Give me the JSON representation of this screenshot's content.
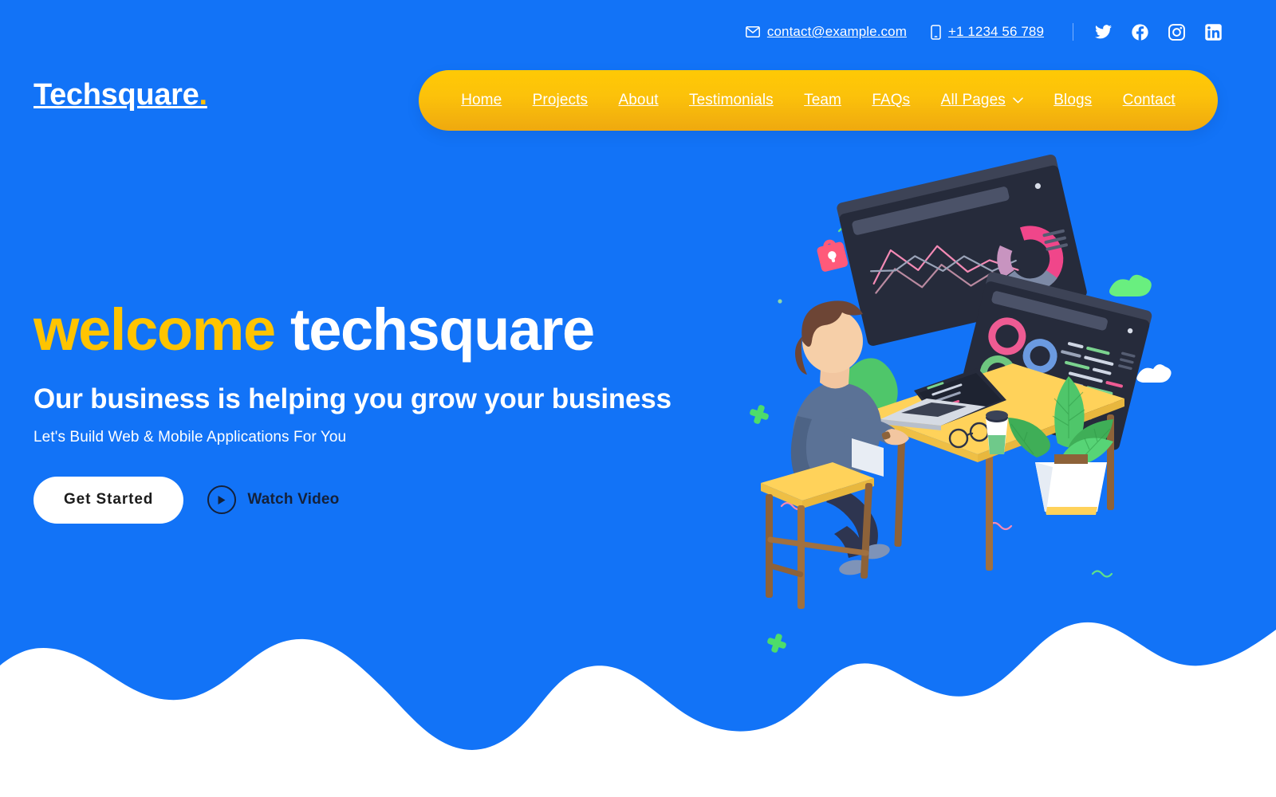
{
  "theme": {
    "brand_blue": "#1273F7",
    "accent_yellow": "#FFC400",
    "nav_gradient_top": "#FFC905",
    "nav_gradient_bottom": "#EFA90F",
    "text_white": "#FFFFFF",
    "text_dark": "#14213A",
    "page_background": "#FFFFFF"
  },
  "topbar": {
    "email_icon": "envelope-icon",
    "email": "contact@example.com",
    "phone_icon": "mobile-phone-icon",
    "phone": "+1 1234 56 789",
    "socials": [
      {
        "name": "twitter-icon",
        "label": "Twitter"
      },
      {
        "name": "facebook-icon",
        "label": "Facebook"
      },
      {
        "name": "instagram-icon",
        "label": "Instagram"
      },
      {
        "name": "linkedin-icon",
        "label": "LinkedIn"
      }
    ]
  },
  "header": {
    "logo_text": "Techsquare",
    "logo_dot": ".",
    "nav": [
      {
        "label": "Home",
        "has_dropdown": false
      },
      {
        "label": "Projects",
        "has_dropdown": false
      },
      {
        "label": "About",
        "has_dropdown": false
      },
      {
        "label": "Testimonials",
        "has_dropdown": false
      },
      {
        "label": "Team",
        "has_dropdown": false
      },
      {
        "label": "FAQs",
        "has_dropdown": false
      },
      {
        "label": "All Pages",
        "has_dropdown": true
      },
      {
        "label": "Blogs",
        "has_dropdown": false
      },
      {
        "label": "Contact",
        "has_dropdown": false
      }
    ]
  },
  "hero": {
    "headline_highlight": "welcome",
    "headline_rest": "techsquare",
    "subheadline": "Our business is helping you grow your business",
    "tagline": "Let's Build Web & Mobile Applications For You",
    "primary_button": "Get Started",
    "video_button": "Watch Video",
    "play_icon": "play-icon",
    "illustration_alt": "Isometric illustration of a developer at a desk with a laptop and floating dashboard screens"
  }
}
